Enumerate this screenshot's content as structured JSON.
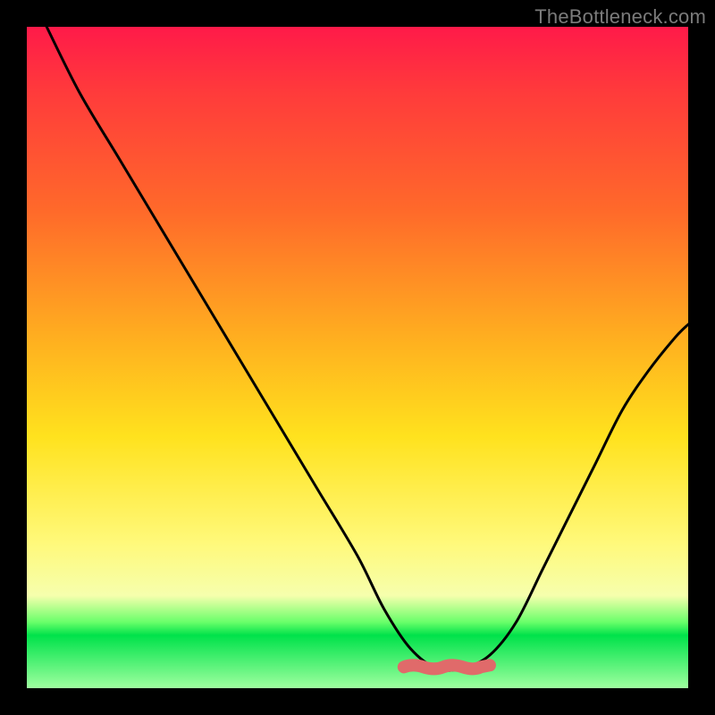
{
  "watermark": "TheBottleneck.com",
  "colors": {
    "background": "#000000",
    "gradient_stops": [
      "#ff1a49",
      "#ff3b3b",
      "#ff6a2a",
      "#ffb21f",
      "#ffe21e",
      "#fff97a",
      "#f6ffad",
      "#6aff6a",
      "#00e24a",
      "#9fff9f"
    ],
    "curve": "#000000",
    "marker": "#e06a6a"
  },
  "chart_data": {
    "type": "line",
    "title": "",
    "xlabel": "",
    "ylabel": "",
    "xlim": [
      0,
      100
    ],
    "ylim": [
      0,
      100
    ],
    "series": [
      {
        "name": "bottleneck-curve",
        "x": [
          3,
          8,
          14,
          20,
          26,
          32,
          38,
          44,
          50,
          54,
          58,
          62,
          66,
          70,
          74,
          78,
          82,
          86,
          90,
          94,
          98,
          100
        ],
        "y": [
          100,
          90,
          80,
          70,
          60,
          50,
          40,
          30,
          20,
          12,
          6,
          3,
          3,
          5,
          10,
          18,
          26,
          34,
          42,
          48,
          53,
          55
        ]
      }
    ],
    "markers": [
      {
        "name": "flat-min-highlight",
        "x_range": [
          57,
          70
        ],
        "y": 3.2
      }
    ]
  }
}
